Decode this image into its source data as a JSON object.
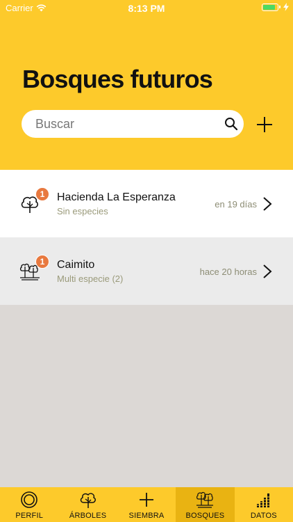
{
  "status_bar": {
    "carrier": "Carrier",
    "time": "8:13 PM"
  },
  "header": {
    "title": "Bosques futuros"
  },
  "search": {
    "placeholder": "Buscar"
  },
  "forests": [
    {
      "title": "Hacienda La Esperanza",
      "subtitle": "Sin especies",
      "time": "en 19 días",
      "badge": "1",
      "icon": "single-tree-icon"
    },
    {
      "title": "Caimito",
      "subtitle": "Multi especie (2)",
      "time": "hace 20 horas",
      "badge": "1",
      "icon": "forest-icon"
    }
  ],
  "tabbar": {
    "items": [
      {
        "label": "PERFIL",
        "icon": "profile-circle-icon"
      },
      {
        "label": "ÁRBOLES",
        "icon": "tree-icon"
      },
      {
        "label": "SIEMBRA",
        "icon": "plus-icon"
      },
      {
        "label": "BOSQUES",
        "icon": "forest-icon",
        "active": true
      },
      {
        "label": "DATOS",
        "icon": "bars-icon"
      }
    ]
  },
  "colors": {
    "brand": "#fdca2b",
    "active_tab": "#e9b312",
    "badge": "#e8793f"
  }
}
